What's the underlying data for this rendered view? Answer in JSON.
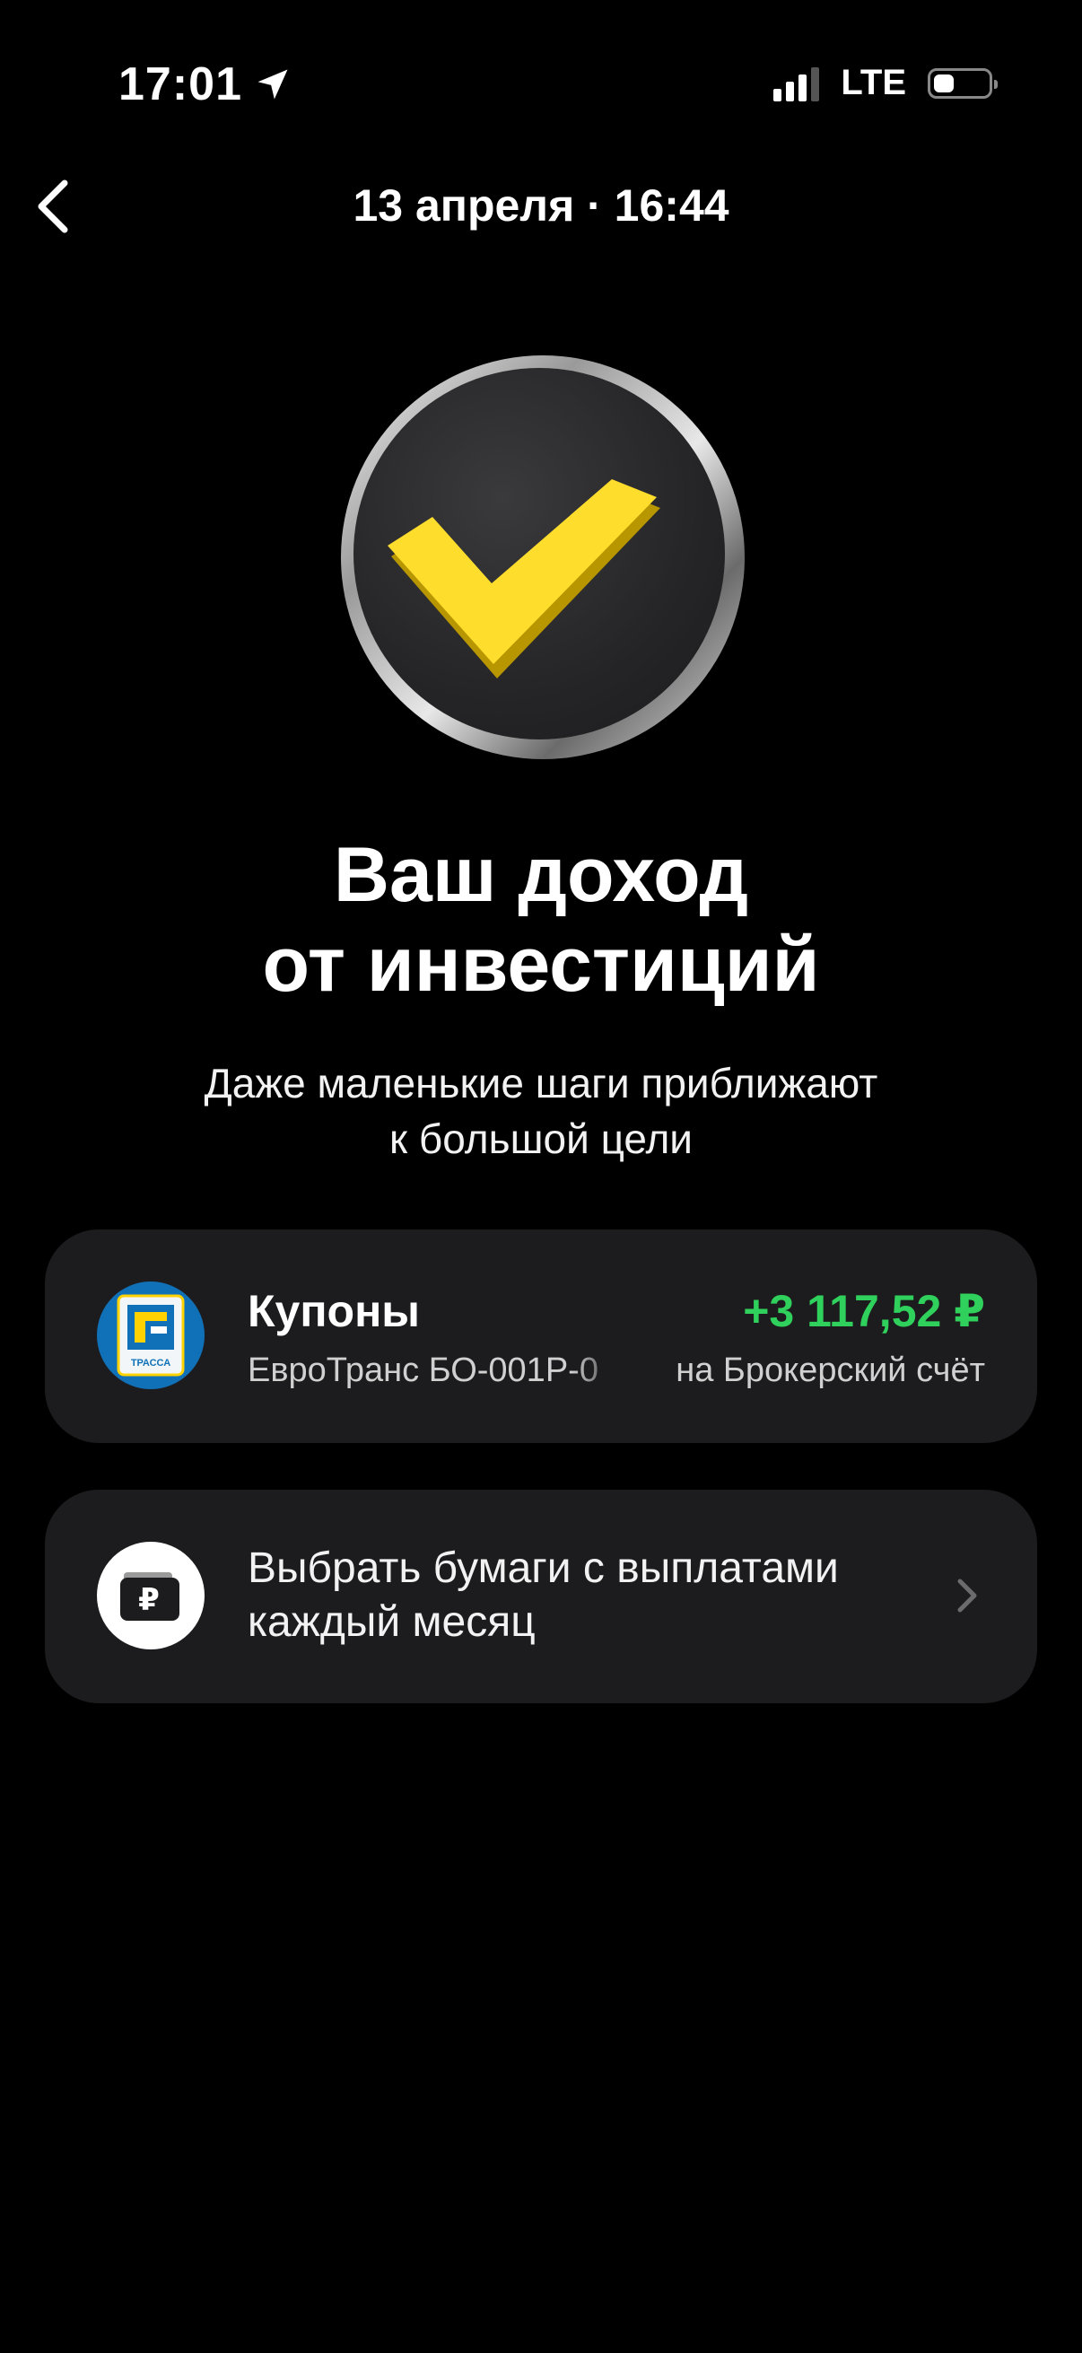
{
  "status_bar": {
    "time": "17:01",
    "network": "LTE"
  },
  "nav": {
    "title": "13 апреля · 16:44"
  },
  "hero": {
    "title_line1": "Ваш доход",
    "title_line2": "от инвестиций",
    "subtitle_line1": "Даже маленькие шаги приближают",
    "subtitle_line2": "к большой цели"
  },
  "coupon_card": {
    "title": "Купоны",
    "amount": "+3 117,52 ₽",
    "security": "ЕвроТранс БО-001Р-0",
    "destination": "на Брокерский счёт",
    "logo_text": "ТРАССА",
    "amount_color": "#2fd05b"
  },
  "choose_card": {
    "label_line1": "Выбрать бумаги с выплатами",
    "label_line2": "каждый месяц"
  },
  "colors": {
    "background": "#000000",
    "card": "#1c1c1e",
    "accent_yellow": "#ffdd2d",
    "positive_green": "#2fd05b"
  },
  "icons": {
    "location": "location-arrow-icon",
    "back": "chevron-left-icon",
    "hero": "checkmark-coin-icon",
    "wallet": "wallet-ruble-icon",
    "chevron": "chevron-right-icon"
  }
}
